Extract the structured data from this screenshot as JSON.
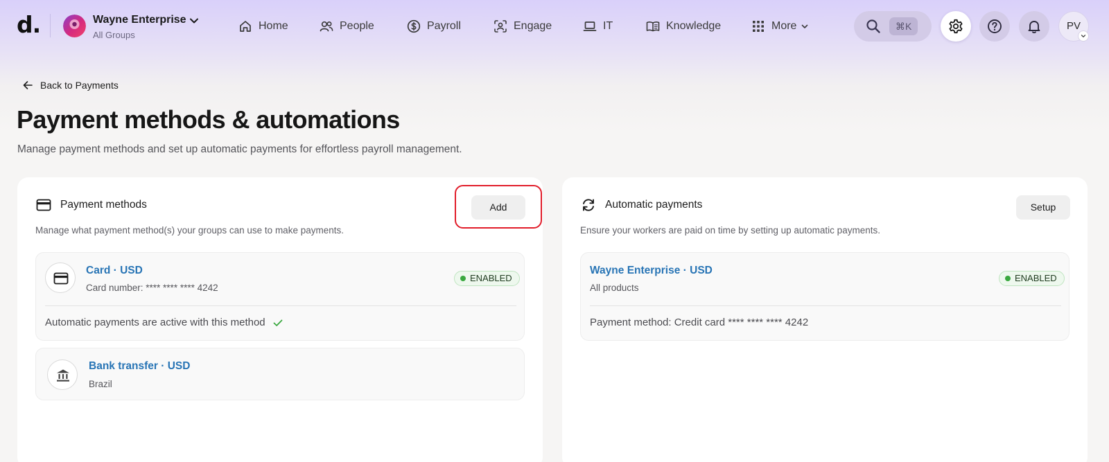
{
  "nav": {
    "logo": "d.",
    "org": {
      "name": "Wayne Enterprise",
      "group": "All Groups"
    },
    "items": [
      {
        "label": "Home",
        "icon": "home-icon"
      },
      {
        "label": "People",
        "icon": "people-icon"
      },
      {
        "label": "Payroll",
        "icon": "dollar-icon"
      },
      {
        "label": "Engage",
        "icon": "engage-icon"
      },
      {
        "label": "IT",
        "icon": "laptop-icon"
      },
      {
        "label": "Knowledge",
        "icon": "book-icon"
      },
      {
        "label": "More",
        "icon": "grid-icon"
      }
    ],
    "search_shortcut": "⌘K",
    "user_initials": "PV"
  },
  "page": {
    "back_label": "Back to Payments",
    "title": "Payment methods & automations",
    "subtitle": "Manage payment methods and set up automatic payments for effortless payroll management."
  },
  "payment_methods": {
    "title": "Payment methods",
    "description": "Manage what payment method(s) your groups can use to make payments.",
    "add_label": "Add",
    "items": [
      {
        "title": "Card · USD",
        "subtitle": "Card number: **** **** **** 4242",
        "status": "ENABLED",
        "note": "Automatic payments are active with this method"
      },
      {
        "title": "Bank transfer · USD",
        "subtitle": "Brazil"
      }
    ]
  },
  "automatic_payments": {
    "title": "Automatic payments",
    "description": "Ensure your workers are paid on time by setting up automatic payments.",
    "setup_label": "Setup",
    "items": [
      {
        "title": "Wayne Enterprise · USD",
        "subtitle": "All products",
        "status": "ENABLED",
        "note": "Payment method: Credit card **** **** **** 4242"
      }
    ]
  },
  "colors": {
    "accent_link": "#2774b5",
    "enabled_green": "#3aa83f",
    "highlight_red": "#e11d2a",
    "nav_gradient": "#d9d0fa"
  }
}
